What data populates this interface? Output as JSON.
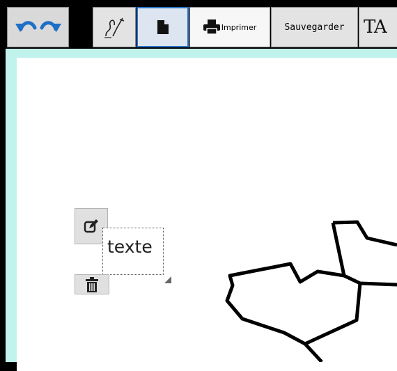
{
  "toolbar": {
    "undo_icon": "undo-icon",
    "redo_icon": "redo-icon",
    "draw_icon": "freehand-draw-icon",
    "page_icon": "page-icon",
    "print_icon": "printer-icon",
    "print_label": "Imprimer",
    "save_label": "Sauvegarder",
    "font_label": "TA",
    "accent_color": "#2b73c7",
    "undo_color": "#1f6fc7"
  },
  "canvas": {
    "frame_color": "#c1f2ec",
    "text_widget": {
      "edit_icon": "edit-icon",
      "text": "texte",
      "delete_icon": "trash-icon"
    }
  }
}
